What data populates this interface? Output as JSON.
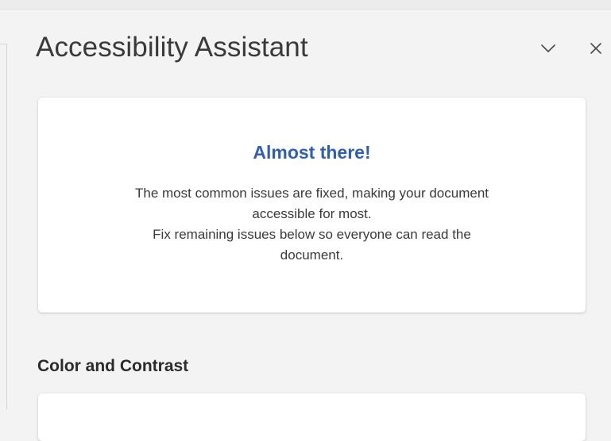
{
  "pane": {
    "title": "Accessibility Assistant",
    "collapse_icon": "chevron-down-icon",
    "close_icon": "close-icon"
  },
  "summary": {
    "title": "Almost there!",
    "line_1": "The most common issues are fixed, making your document",
    "line_2": "accessible for most.",
    "line_3": "Fix remaining issues below so everyone can read the",
    "line_4": "document."
  },
  "sections": [
    {
      "heading": "Color and Contrast"
    }
  ],
  "colors": {
    "accent": "#2f5fb1",
    "pane_background": "#f3f3f3",
    "card_background": "#ffffff"
  }
}
